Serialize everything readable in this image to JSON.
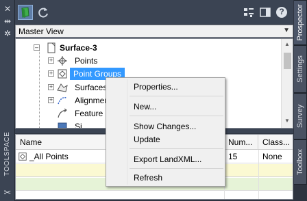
{
  "left_strip": {
    "close_icon": "close-icon",
    "pin_icon": "auto-hide-icon",
    "settings_icon": "gear-icon",
    "title": "TOOLSPACE",
    "tools_icon": "tools-icon"
  },
  "toolbar": {
    "buttons": [
      "prospector-active-icon",
      "refresh-icon",
      "item-view-icon",
      "panel-view-icon",
      "help-icon"
    ],
    "help_glyph": "?"
  },
  "right_tabs": [
    "Prospector",
    "Settings",
    "Survey",
    "Toolbox"
  ],
  "view_combo": {
    "value": "Master View"
  },
  "tree": {
    "root": "Surface-3",
    "items": [
      "Points",
      "Point Groups",
      "Surfaces",
      "Alignmen",
      "Feature Li",
      "Si"
    ]
  },
  "list": {
    "columns": [
      "Name",
      "Num...",
      "Class..."
    ],
    "rows": [
      {
        "name": "_All Points",
        "num": "15",
        "class": "None"
      }
    ]
  },
  "context_menu": {
    "items": [
      "Properties...",
      "New...",
      "Show Changes...",
      "Update",
      "Export LandXML...",
      "Refresh"
    ]
  },
  "colors": {
    "selection": "#3399ff",
    "panel_dark": "#3b4453",
    "yellow_row": "#fbf9d2",
    "green_row": "#e6f3d7"
  }
}
